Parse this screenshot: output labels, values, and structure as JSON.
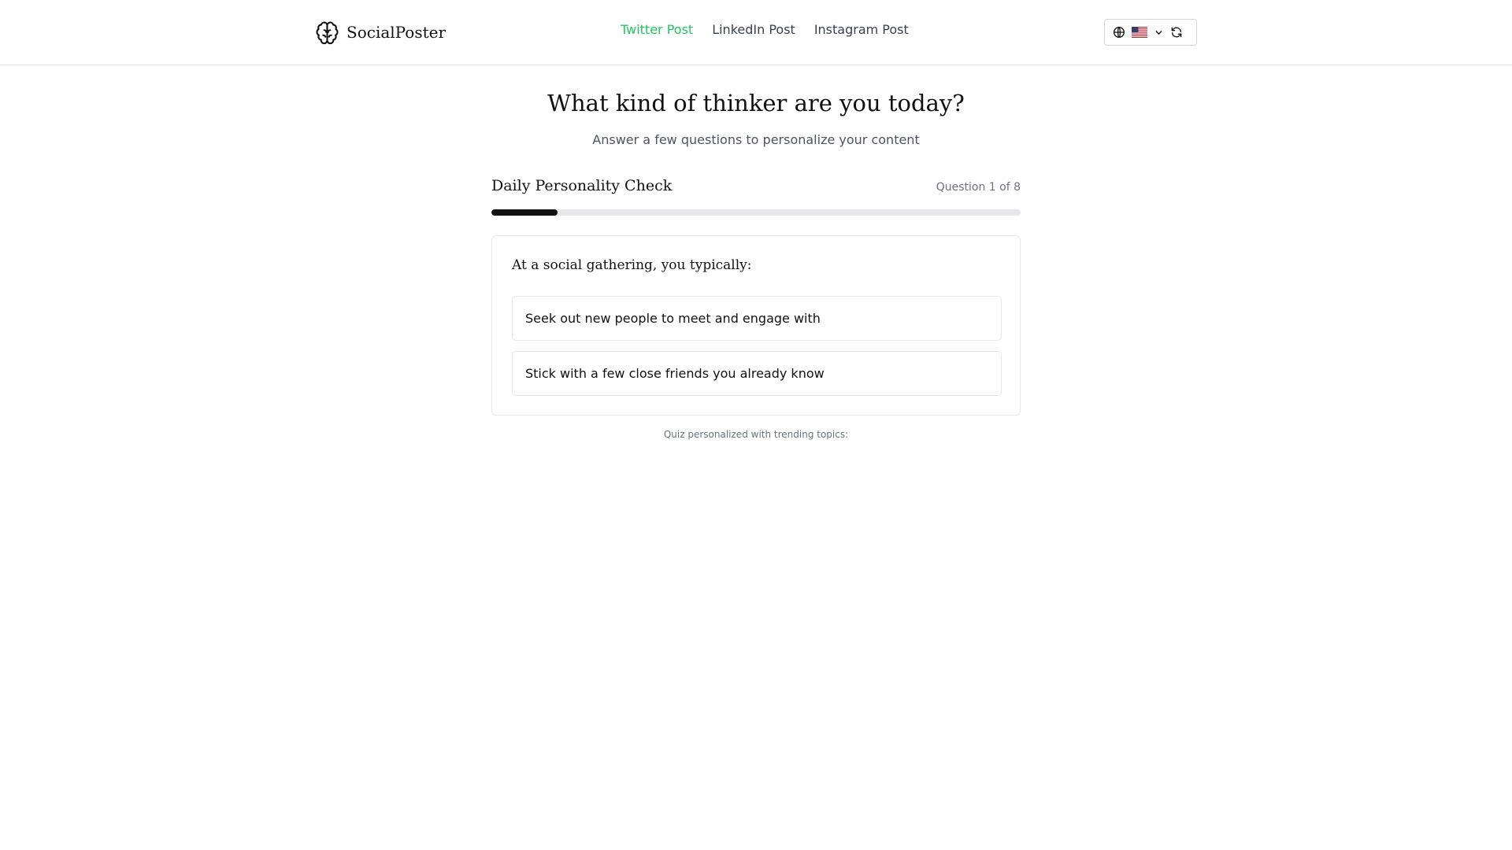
{
  "app": {
    "brand": "SocialPoster"
  },
  "nav": {
    "items": [
      {
        "label": "Twitter Post",
        "active": true
      },
      {
        "label": "LinkedIn Post",
        "active": false
      },
      {
        "label": "Instagram Post",
        "active": false
      }
    ]
  },
  "language": {
    "icons": [
      "globe-icon",
      "us-flag-icon",
      "chevron-down-icon",
      "refresh-icon"
    ]
  },
  "page": {
    "title": "What kind of thinker are you today?",
    "subtitle": "Answer a few questions to personalize your content"
  },
  "quiz": {
    "title": "Daily Personality Check",
    "counter": "Question 1 of 8",
    "progress_fraction": 0.125,
    "question": "At a social gathering, you typically:",
    "options": [
      "Seek out new people to meet and engage with",
      "Stick with a few close friends you already know"
    ],
    "footnote": "Quiz personalized with trending topics:"
  },
  "colors": {
    "accent": "#22c55e",
    "progress": "#111111",
    "progress_track": "#e5e7eb",
    "border": "#e5e7eb"
  }
}
